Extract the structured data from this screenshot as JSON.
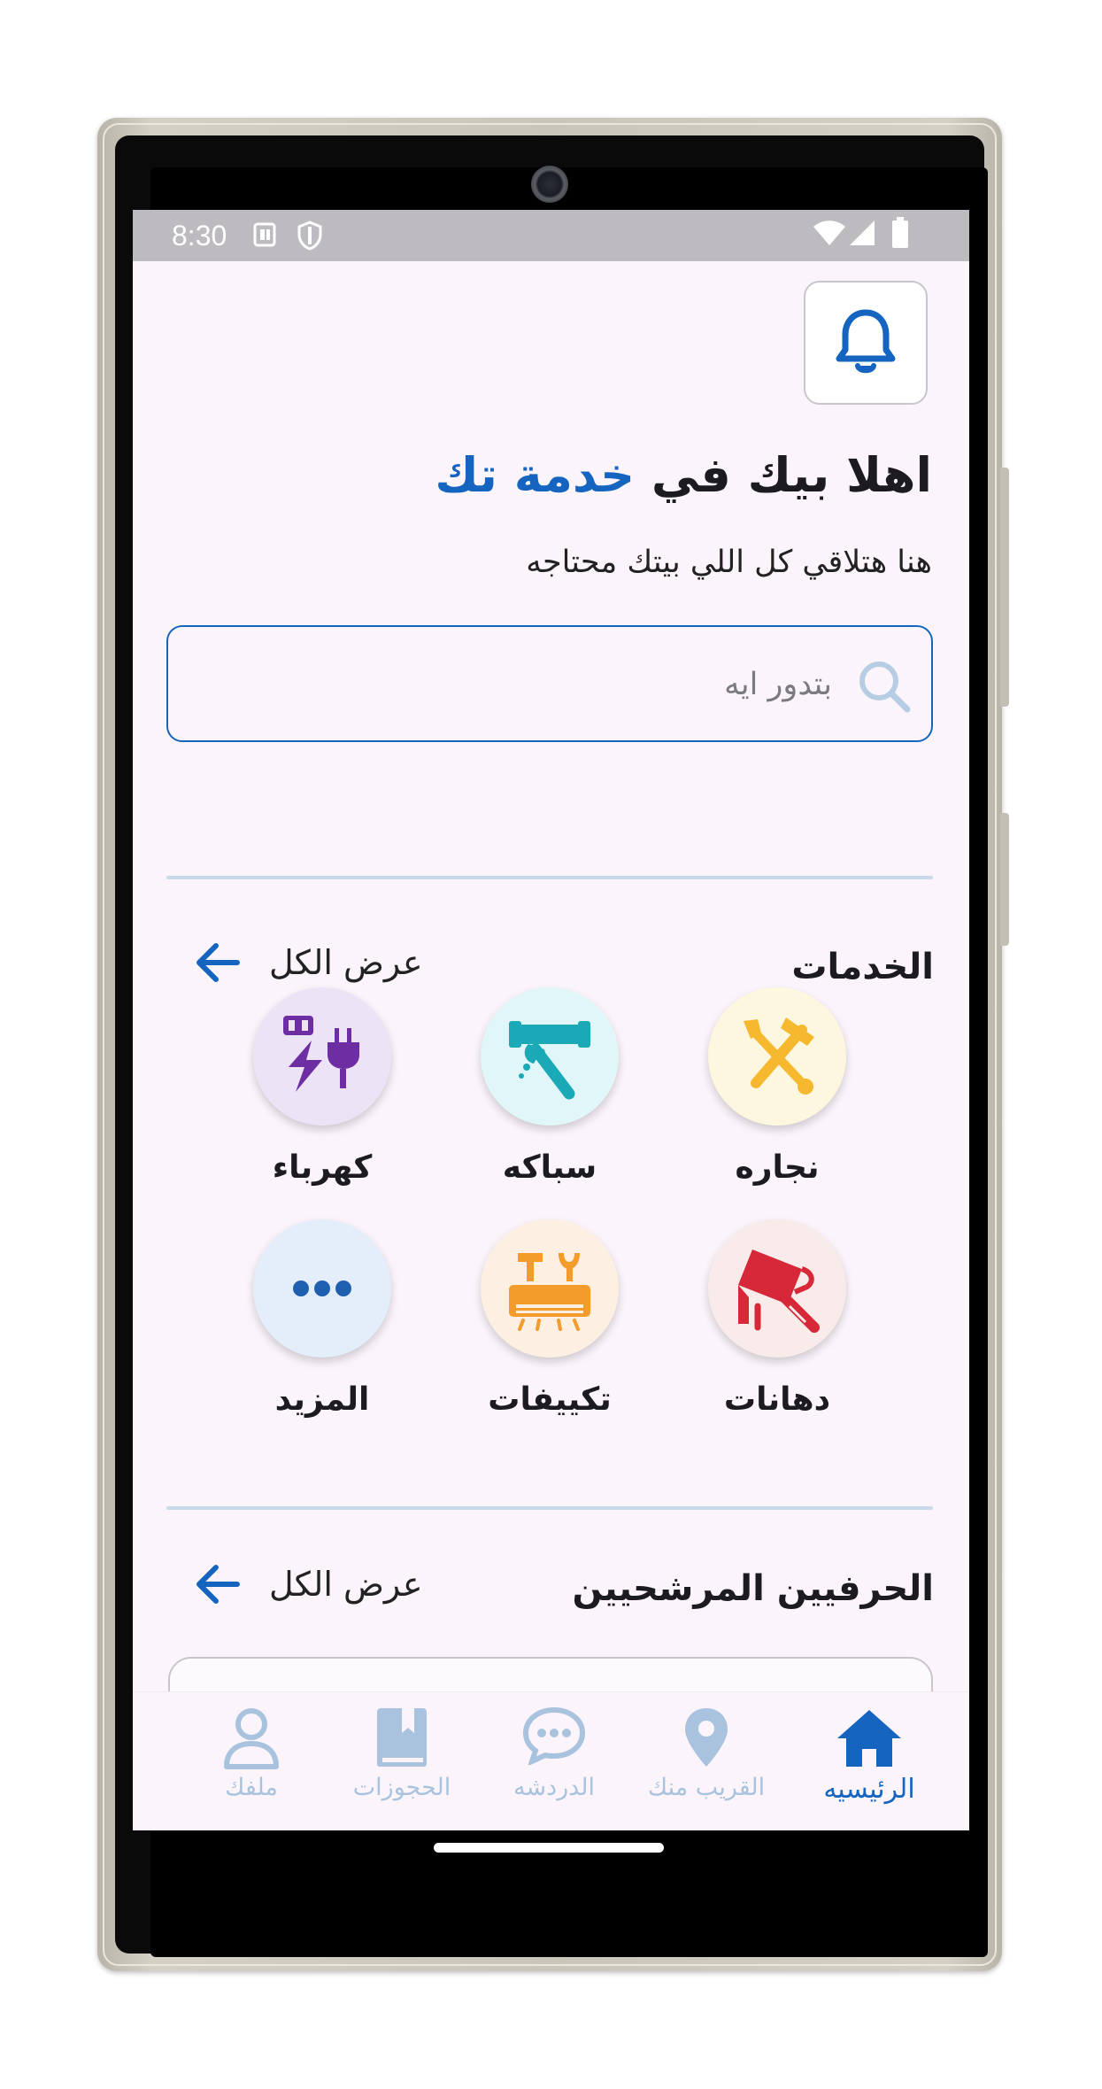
{
  "status_bar": {
    "time": "8:30",
    "icons": [
      "sim-card-icon",
      "shield-icon",
      "wifi-icon",
      "signal-icon",
      "battery-icon"
    ]
  },
  "header": {
    "notification_icon": "bell-icon"
  },
  "welcome": {
    "prefix": "اهلا بيك في ",
    "brand": "خدمة تك",
    "subtitle": "هنا هتلاقي كل اللي بيتك محتاجه"
  },
  "search": {
    "placeholder": "بتدور ايه",
    "value": ""
  },
  "services_section": {
    "title": "الخدمات",
    "view_all": "عرض الكل",
    "items": [
      {
        "label": "نجاره",
        "icon": "carpentry-tools-icon",
        "bg": "#fdf7df",
        "color": "#f5b82e"
      },
      {
        "label": "سباكه",
        "icon": "plumbing-icon",
        "bg": "#e1f6f8",
        "color": "#1aa9b7"
      },
      {
        "label": "كهرباء",
        "icon": "electric-plug-icon",
        "bg": "#ece4f6",
        "color": "#6d2da3"
      },
      {
        "label": "دهانات",
        "icon": "paint-roller-icon",
        "bg": "#f8ebe9",
        "color": "#d7283a"
      },
      {
        "label": "تكييفات",
        "icon": "air-conditioner-icon",
        "bg": "#fdf0e2",
        "color": "#f39b2b"
      },
      {
        "label": "المزيد",
        "icon": "more-dots-icon",
        "bg": "#e4eefa",
        "color": "#1f5fb0"
      }
    ]
  },
  "craftsmen_section": {
    "title": "الحرفيين المرشحيين",
    "view_all": "عرض الكل"
  },
  "bottom_nav": {
    "items": [
      {
        "label": "الرئيسيه",
        "icon": "home-icon",
        "active": true
      },
      {
        "label": "القريب منك",
        "icon": "location-pin-icon",
        "active": false
      },
      {
        "label": "الدردشه",
        "icon": "chat-bubble-icon",
        "active": false
      },
      {
        "label": "الحجوزات",
        "icon": "bookmark-book-icon",
        "active": false
      },
      {
        "label": "ملفك",
        "icon": "profile-icon",
        "active": false
      }
    ]
  },
  "colors": {
    "primary": "#1565c0",
    "background": "#fbf5fb",
    "nav_inactive": "#a9c3df",
    "divider": "#c7d9ea"
  }
}
